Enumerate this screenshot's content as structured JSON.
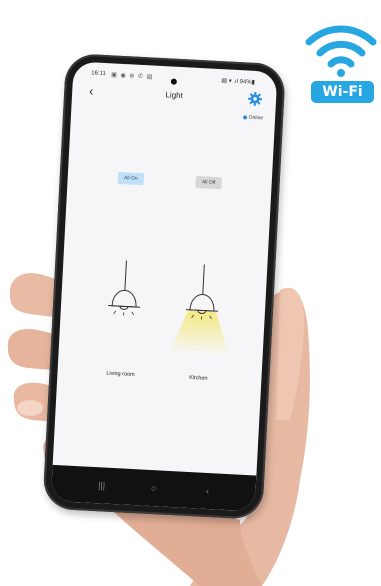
{
  "status_bar": {
    "time": "16:11",
    "left_icons": "▣ ◉ ⊛ ✆ ▤",
    "right": "▤ ▾ .ıl 94%▮"
  },
  "header": {
    "title": "Light",
    "back_icon": "chevron-left-icon",
    "settings_icon": "gear-icon"
  },
  "status": {
    "online_label": "Online",
    "dot_color": "#2b8fe0"
  },
  "controls": {
    "all_on_label": "All On",
    "all_off_label": "All Off"
  },
  "lamps": [
    {
      "label": "Living room",
      "state": "off"
    },
    {
      "label": "Kitchen",
      "state": "on",
      "glow_color": "#f4e87a"
    }
  ],
  "nav": {
    "recents": "|||",
    "home": "○",
    "back": "‹"
  },
  "badge": {
    "label": "Wi-Fi",
    "color": "#27a7e1"
  }
}
